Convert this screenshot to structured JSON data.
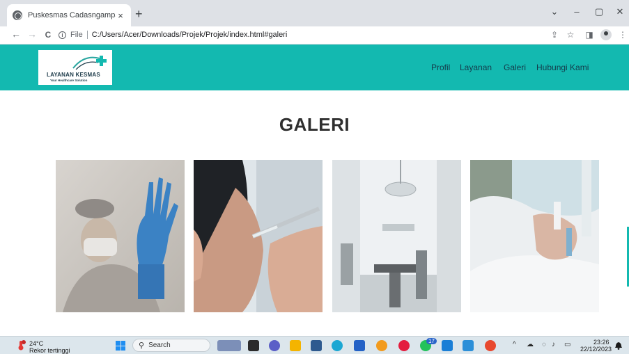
{
  "browser": {
    "tab_title": "Puskesmas Cadasngampar",
    "tab_close": "×",
    "new_tab": "+",
    "window_controls": {
      "minimize": "–",
      "restore": "▢",
      "close": "✕",
      "tab_search": "⌄"
    },
    "nav": {
      "back": "←",
      "forward": "→",
      "reload": "C"
    },
    "address": {
      "scheme_label": "File",
      "url": "C:/Users/Acer/Downloads/Projek/Projek/index.html#galeri"
    },
    "toolbar_icons": [
      "share-icon",
      "star-icon",
      "sidepanel-icon",
      "profile-icon",
      "menu-icon"
    ]
  },
  "site": {
    "logo_text": "LAYANAN KESMAS",
    "logo_subtext": "Your Healthcare Solution",
    "nav_links": [
      "Profil",
      "Layanan",
      "Galeri",
      "Hubungi Kami"
    ],
    "section_title": "GALERI",
    "accent_color": "#13b9b0"
  },
  "taskbar": {
    "weather_temp": "24°C",
    "weather_desc": "Rekor tertinggi",
    "search_label": "Search",
    "clock_time": "23:26",
    "clock_date": "22/12/2023",
    "whatsapp_badge": "17"
  }
}
